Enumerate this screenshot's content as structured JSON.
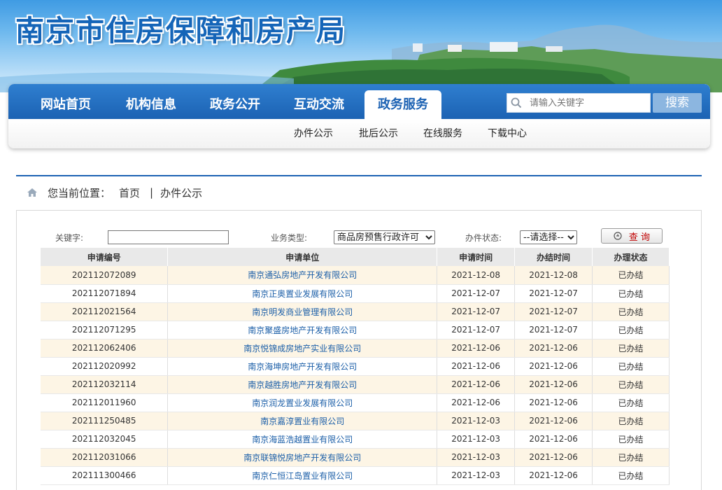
{
  "site": {
    "title": "南京市住房保障和房产局"
  },
  "nav": {
    "items": [
      "网站首页",
      "机构信息",
      "政务公开",
      "互动交流",
      "政务服务"
    ],
    "active_index": 4,
    "search_placeholder": "请输入关键字",
    "search_button": "搜索",
    "sub_items": [
      "办件公示",
      "批后公示",
      "在线服务",
      "下载中心"
    ]
  },
  "breadcrumb": {
    "prefix": "您当前位置：",
    "home": "首页",
    "separator": "|",
    "current": "办件公示"
  },
  "filters": {
    "keyword_label": "关键字:",
    "keyword_value": "",
    "type_label": "业务类型:",
    "type_selected": "商品房预售行政许可",
    "status_label": "办件状态:",
    "status_selected": "--请选择--",
    "query_button": "查 询"
  },
  "table": {
    "headers": [
      "申请编号",
      "申请单位",
      "申请时间",
      "办结时间",
      "办理状态"
    ],
    "rows": [
      [
        "202112072089",
        "南京通弘房地产开发有限公司",
        "2021-12-08",
        "2021-12-08",
        "已办结"
      ],
      [
        "202112071894",
        "南京正奥置业发展有限公司",
        "2021-12-07",
        "2021-12-07",
        "已办结"
      ],
      [
        "202112021564",
        "南京明发商业管理有限公司",
        "2021-12-07",
        "2021-12-07",
        "已办结"
      ],
      [
        "202112071295",
        "南京聚盛房地产开发有限公司",
        "2021-12-07",
        "2021-12-07",
        "已办结"
      ],
      [
        "202112062406",
        "南京悦锦成房地产实业有限公司",
        "2021-12-06",
        "2021-12-06",
        "已办结"
      ],
      [
        "202112020992",
        "南京海坤房地产开发有限公司",
        "2021-12-06",
        "2021-12-06",
        "已办结"
      ],
      [
        "202112032114",
        "南京越胜房地产开发有限公司",
        "2021-12-06",
        "2021-12-06",
        "已办结"
      ],
      [
        "202112011960",
        "南京润龙置业发展有限公司",
        "2021-12-06",
        "2021-12-06",
        "已办结"
      ],
      [
        "202111250485",
        "南京嘉淳置业有限公司",
        "2021-12-03",
        "2021-12-06",
        "已办结"
      ],
      [
        "202112032045",
        "南京海蓝浩越置业有限公司",
        "2021-12-03",
        "2021-12-06",
        "已办结"
      ],
      [
        "202112031066",
        "南京联锦悦房地产开发有限公司",
        "2021-12-03",
        "2021-12-06",
        "已办结"
      ],
      [
        "202111300466",
        "南京仁恒江岛置业有限公司",
        "2021-12-03",
        "2021-12-06",
        "已办结"
      ]
    ]
  }
}
